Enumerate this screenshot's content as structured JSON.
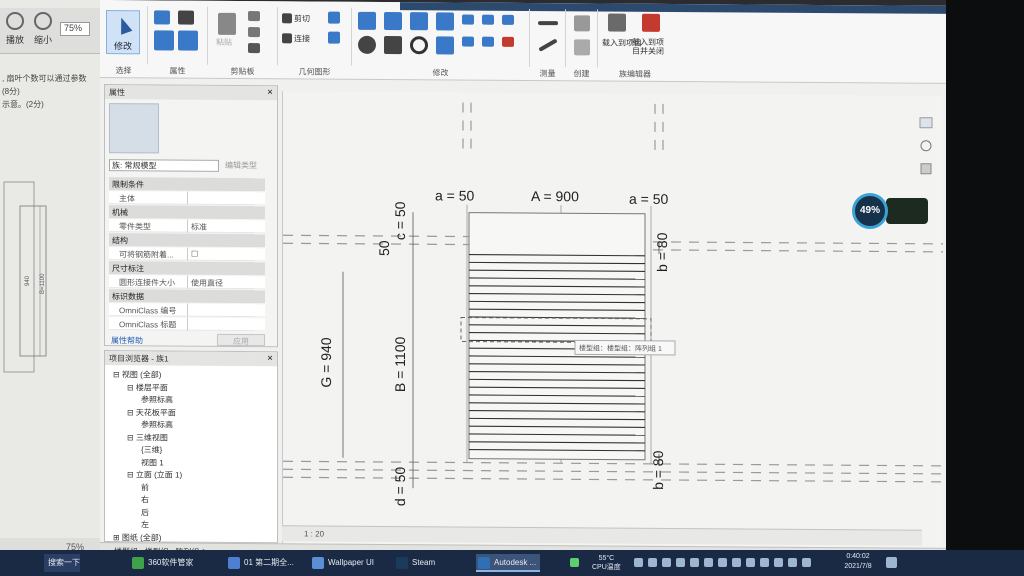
{
  "pdf_viewer": {
    "play_label": "播放",
    "zoom_out_label": "缩小",
    "zoom_value": "75%",
    "text_lines": [
      ", 扇叶个数可以通过参数",
      "(8分)",
      "示意。(2分)"
    ],
    "drawing_labels": [
      "940",
      "B=1100"
    ],
    "zoom_bottom": "75%"
  },
  "ribbon": {
    "modify_label": "修改",
    "select_label": "选择",
    "properties_label": "属性",
    "clipboard_label": "剪贴板",
    "paste_label": "粘贴",
    "cut_label": "剪切",
    "join_label": "连接",
    "geometry_label": "几何图形",
    "modify_group_label": "修改",
    "measure_label": "测量",
    "create_label": "创建",
    "load_project_label": "载入到项目",
    "load_close_label": "载入到项目并关闭",
    "family_editor_label": "族编辑器"
  },
  "properties": {
    "title": "属性",
    "type_value": "族: 常规模型",
    "edit_type": "编辑类型",
    "rows": [
      {
        "kind": "cat",
        "label": "限制条件"
      },
      {
        "kind": "item",
        "label": "主体",
        "value": ""
      },
      {
        "kind": "cat",
        "label": "机械"
      },
      {
        "kind": "item",
        "label": "零件类型",
        "value": "标准"
      },
      {
        "kind": "cat",
        "label": "结构"
      },
      {
        "kind": "item",
        "label": "可将钢筋附着...",
        "value": "☐"
      },
      {
        "kind": "cat",
        "label": "尺寸标注"
      },
      {
        "kind": "item",
        "label": "圆形连接件大小",
        "value": "使用直径"
      },
      {
        "kind": "cat",
        "label": "标识数据"
      },
      {
        "kind": "item",
        "label": "OmniClass 编号",
        "value": ""
      },
      {
        "kind": "item",
        "label": "OmniClass 标题",
        "value": ""
      }
    ],
    "help_link": "属性帮助",
    "apply_label": "应用"
  },
  "project_browser": {
    "title": "项目浏览器 - 族1",
    "items": [
      {
        "label": "⊟ 视图 (全部)",
        "level": 0
      },
      {
        "label": "⊟ 楼层平面",
        "level": 1
      },
      {
        "label": "参照标高",
        "level": 2
      },
      {
        "label": "⊟ 天花板平面",
        "level": 1
      },
      {
        "label": "参照标高",
        "level": 2
      },
      {
        "label": "⊟ 三维视图",
        "level": 1
      },
      {
        "label": "{三维}",
        "level": 2
      },
      {
        "label": "视图 1",
        "level": 2
      },
      {
        "label": "⊟ 立面 (立面 1)",
        "level": 1
      },
      {
        "label": "前",
        "level": 2
      },
      {
        "label": "右",
        "level": 2
      },
      {
        "label": "后",
        "level": 2
      },
      {
        "label": "左",
        "level": 2
      },
      {
        "label": "⊞ 图纸 (全部)",
        "level": 0
      }
    ]
  },
  "canvas": {
    "dims": {
      "a_left": "a = 50",
      "A": "A = 900",
      "a_right": "a = 50",
      "c_top": "c = 50",
      "d_top": "50",
      "b_top": "b = 80",
      "G": "G = 940",
      "B": "B = 1100",
      "b_bottom": "b = 80",
      "d_bottom": "d = 50"
    },
    "tooltip": "楼型组：楼型组：阵列组 1",
    "scale": "1 : 20"
  },
  "status_bar": {
    "text": "楼型组 : 楼型组 : 阵列组 1"
  },
  "cpu": {
    "percent": "49%"
  },
  "taskbar": {
    "search": "搜索一下",
    "tasks": [
      {
        "label": "360软件管家",
        "color": "#3fa24a"
      },
      {
        "label": "01 第二期全...",
        "color": "#4d7fd3"
      },
      {
        "label": "Wallpaper UI",
        "color": "#5a8fd6"
      },
      {
        "label": "Steam",
        "color": "#1b3b5a"
      },
      {
        "label": "Autodesk ...",
        "color": "#2f6fb6"
      }
    ],
    "cpu_temp": "55°C",
    "cpu_temp_label": "CPU温度",
    "time": "0:40:02",
    "date": "2021/7/8"
  }
}
